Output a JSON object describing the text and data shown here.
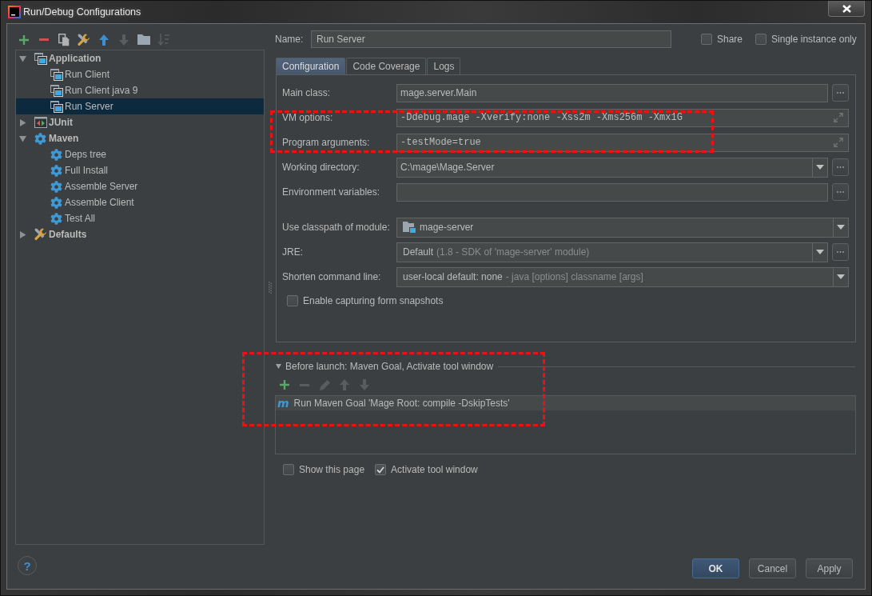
{
  "window": {
    "title": "Run/Debug Configurations"
  },
  "left_toolbar": [
    {
      "kind": "add",
      "disabled": false
    },
    {
      "kind": "remove",
      "disabled": false
    },
    {
      "kind": "copy",
      "disabled": false
    },
    {
      "kind": "edit-defaults",
      "disabled": false
    },
    {
      "kind": "move-up",
      "disabled": false
    },
    {
      "kind": "move-down",
      "disabled": true
    },
    {
      "kind": "folder",
      "disabled": false
    },
    {
      "kind": "sort",
      "disabled": true
    }
  ],
  "tree": [
    {
      "label": "Application",
      "kind": "application",
      "expanded": true,
      "selected": false,
      "children": [
        {
          "label": "Run Client",
          "kind": "application",
          "selected": false
        },
        {
          "label": "Run Client java 9",
          "kind": "application",
          "selected": false
        },
        {
          "label": "Run Server",
          "kind": "application",
          "selected": true
        }
      ]
    },
    {
      "label": "JUnit",
      "kind": "junit",
      "expanded": false,
      "selected": false
    },
    {
      "label": "Maven",
      "kind": "maven",
      "expanded": true,
      "selected": false,
      "children": [
        {
          "label": "Deps tree",
          "kind": "maven",
          "selected": false
        },
        {
          "label": "Full Install",
          "kind": "maven",
          "selected": false
        },
        {
          "label": "Assemble Server",
          "kind": "maven",
          "selected": false
        },
        {
          "label": "Assemble Client",
          "kind": "maven",
          "selected": false
        },
        {
          "label": "Test All",
          "kind": "maven",
          "selected": false
        }
      ]
    },
    {
      "label": "Defaults",
      "kind": "defaults",
      "expanded": false,
      "selected": false
    }
  ],
  "name_field": {
    "label": "Name:",
    "value": "Run Server"
  },
  "options": [
    {
      "label": "Share",
      "checked": false
    },
    {
      "label": "Single instance only",
      "checked": false
    }
  ],
  "tabs": [
    {
      "label": "Configuration",
      "selected": true
    },
    {
      "label": "Code Coverage",
      "selected": false
    },
    {
      "label": "Logs",
      "selected": false
    }
  ],
  "form_sections": [
    {
      "rows": [
        {
          "kind": "text",
          "label": "Main class:",
          "value": "mage.server.Main",
          "browse": true
        },
        {
          "kind": "expandable",
          "label": "VM options:",
          "value": "-Ddebug.mage -Xverify:none -Xss2m -Xms256m -Xmx1G",
          "highlighted": true
        },
        {
          "kind": "expandable",
          "label": "Program arguments:",
          "value": "-testMode=true",
          "highlighted": true
        },
        {
          "kind": "editable-combo",
          "label": "Working directory:",
          "value": "C:\\mage\\Mage.Server",
          "browse": true
        },
        {
          "kind": "text",
          "label": "Environment variables:",
          "browse": true
        }
      ]
    },
    {
      "rows": [
        {
          "kind": "module-combo",
          "label": "Use classpath of module:",
          "value": "mage-server"
        },
        {
          "kind": "combo",
          "label": "JRE:",
          "value": "Default",
          "hint": "(1.8 - SDK of 'mage-server' module)",
          "browse": true
        },
        {
          "kind": "combo",
          "label": "Shorten command line:",
          "value": "user-local default: none",
          "hint": "- java [options] classname [args]"
        }
      ]
    }
  ],
  "snapshot_option": {
    "label": "Enable capturing form snapshots",
    "checked": false
  },
  "before_launch": {
    "title": "Before launch: Maven Goal, Activate tool window",
    "expanded": true,
    "highlighted": true,
    "toolbar": [
      {
        "kind": "add",
        "disabled": false
      },
      {
        "kind": "remove",
        "disabled": true
      },
      {
        "kind": "edit",
        "disabled": true
      },
      {
        "kind": "move-up",
        "disabled": true
      },
      {
        "kind": "move-down",
        "disabled": true
      }
    ],
    "tasks": [
      {
        "icon": "m",
        "label": "Run Maven Goal 'Mage Root: compile -DskipTests'",
        "selected": true
      }
    ]
  },
  "launch_options": [
    {
      "label": "Show this page",
      "checked": false
    },
    {
      "label": "Activate tool window",
      "checked": true
    }
  ],
  "help_button": {
    "label": "?"
  },
  "buttons": [
    {
      "label": "OK",
      "kind": "primary"
    },
    {
      "label": "Cancel",
      "kind": "secondary"
    },
    {
      "label": "Apply",
      "kind": "secondary"
    }
  ]
}
